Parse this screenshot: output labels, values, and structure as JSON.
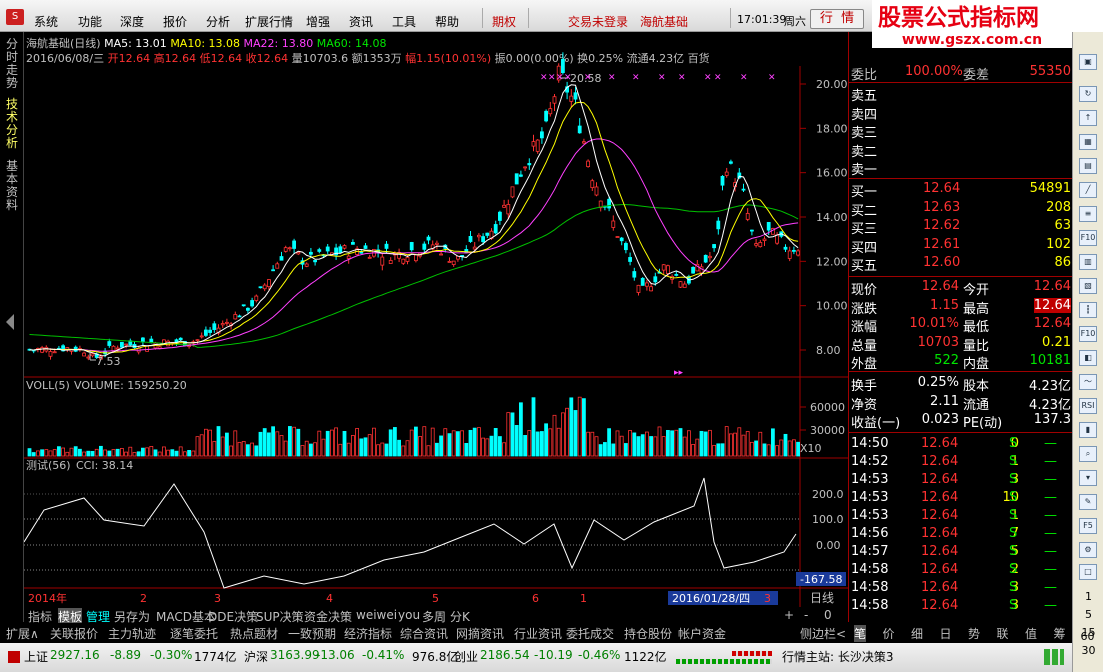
{
  "menu": {
    "items": [
      "系统",
      "功能",
      "深度",
      "报价",
      "分析",
      "扩展行情",
      "增强",
      "资讯",
      "工具",
      "帮助"
    ],
    "options_label": "期权",
    "login_status": "交易未登录",
    "stock_name": "海航基础",
    "time": "17:01:39",
    "weekday": "周六",
    "btn_quote": "行",
    "btn_info": "情",
    "watermark_title": "股票公式指标网",
    "watermark_url": "www.gszx.com.cn"
  },
  "left_tabs": [
    "分时走势",
    "技术分析",
    "基本资料"
  ],
  "chart_header": {
    "name_period": "海航基础(日线)",
    "ma5": "MA5: 13.01",
    "ma10": "MA10: 13.08",
    "ma22": "MA22: 13.80",
    "ma60": "MA60: 14.08",
    "date": "2016/06/08/三",
    "open": "开12.64",
    "high": "高12.64",
    "low": "低12.64",
    "close": "收12.64",
    "vol": "量10703.6",
    "amount": "额1353万",
    "change": "幅1.15(10.01%)",
    "amplitude": "振0.00(0.00%)",
    "turnover": "换0.25%",
    "float": "流通4.23亿",
    "sector": "百货"
  },
  "price_axis": [
    "20.00",
    "18.00",
    "16.00",
    "14.00",
    "12.00",
    "10.00",
    "8.00"
  ],
  "annotations": {
    "high": "20.58",
    "low": "7.53"
  },
  "volume_header": {
    "label": "VOLL(5)",
    "value": "VOLUME: 159250.20"
  },
  "volume_axis": [
    "60000",
    "30000",
    "X10"
  ],
  "cci_header": {
    "label": "测试(56)",
    "value": "CCI: 38.14"
  },
  "cci_axis": [
    "200.0",
    "100.0",
    "0.00",
    "-167.58"
  ],
  "x_axis": [
    "2014年",
    "2",
    "3",
    "4",
    "5",
    "6",
    "1",
    "2016/01/28/四",
    "3"
  ],
  "period_label": "日线",
  "tab_row1": [
    "指标",
    "模板",
    "管理",
    "另存为",
    "MACD基本",
    "DDE决策",
    "SUP决策",
    "资金决策",
    "weiwei",
    "you",
    "多周",
    "分K"
  ],
  "tab_row1_right": [
    "+",
    "-",
    "0"
  ],
  "tab_row2": [
    "扩展∧",
    "关联报价",
    "主力轨迹",
    "逐笔委托",
    "热点题材",
    "一致预期",
    "经济指标",
    "综合资讯",
    "网摘资讯",
    "行业资讯",
    "委托成交",
    "持仓股份",
    "帐户资金"
  ],
  "tab_row2_right": "侧边栏<",
  "side_tabs": [
    "笔",
    "价",
    "细",
    "日",
    "势",
    "联",
    "值",
    "筹"
  ],
  "order_book": {
    "weibi_label": "委比",
    "weibi": "100.00%",
    "weicha_label": "委差",
    "weicha": "55350",
    "asks": [
      {
        "label": "卖五",
        "price": "",
        "vol": ""
      },
      {
        "label": "卖四",
        "price": "",
        "vol": ""
      },
      {
        "label": "卖三",
        "price": "",
        "vol": ""
      },
      {
        "label": "卖二",
        "price": "",
        "vol": ""
      },
      {
        "label": "卖一",
        "price": "",
        "vol": ""
      }
    ],
    "bids": [
      {
        "label": "买一",
        "price": "12.64",
        "vol": "54891"
      },
      {
        "label": "买二",
        "price": "12.63",
        "vol": "208"
      },
      {
        "label": "买三",
        "price": "12.62",
        "vol": "63"
      },
      {
        "label": "买四",
        "price": "12.61",
        "vol": "102"
      },
      {
        "label": "买五",
        "price": "12.60",
        "vol": "86"
      }
    ]
  },
  "quote_stats": [
    {
      "l1": "现价",
      "v1": "12.64",
      "l2": "今开",
      "v2": "12.64"
    },
    {
      "l1": "涨跌",
      "v1": "1.15",
      "l2": "最高",
      "v2": "12.64"
    },
    {
      "l1": "涨幅",
      "v1": "10.01%",
      "l2": "最低",
      "v2": "12.64"
    },
    {
      "l1": "总量",
      "v1": "10703",
      "l2": "量比",
      "v2": "0.21"
    },
    {
      "l1": "外盘",
      "v1": "522",
      "l2": "内盘",
      "v2": "10181"
    }
  ],
  "fund_stats": [
    {
      "l1": "换手",
      "v1": "0.25%",
      "l2": "股本",
      "v2": "4.23亿"
    },
    {
      "l1": "净资",
      "v1": "2.11",
      "l2": "流通",
      "v2": "4.23亿"
    },
    {
      "l1": "收益(一)",
      "v1": "0.023",
      "l2": "PE(动)",
      "v2": "137.3"
    }
  ],
  "ticks": [
    {
      "t": "14:50",
      "p": "12.64",
      "v": "0",
      "s": "S"
    },
    {
      "t": "14:52",
      "p": "12.64",
      "v": "1",
      "s": "S"
    },
    {
      "t": "14:53",
      "p": "12.64",
      "v": "3",
      "s": "S"
    },
    {
      "t": "14:53",
      "p": "12.64",
      "v": "10",
      "s": "S"
    },
    {
      "t": "14:53",
      "p": "12.64",
      "v": "1",
      "s": "S"
    },
    {
      "t": "14:56",
      "p": "12.64",
      "v": "7",
      "s": "S"
    },
    {
      "t": "14:57",
      "p": "12.64",
      "v": "5",
      "s": "S"
    },
    {
      "t": "14:58",
      "p": "12.64",
      "v": "2",
      "s": "S"
    },
    {
      "t": "14:58",
      "p": "12.64",
      "v": "3",
      "s": "S"
    },
    {
      "t": "14:58",
      "p": "12.64",
      "v": "3",
      "s": "S"
    }
  ],
  "icon_numbers": [
    "1",
    "5",
    "15",
    "30",
    "60"
  ],
  "statusbar": {
    "sh_label": "上证",
    "sh_val": "2927.16",
    "sh_chg": "-8.89",
    "sh_pct": "-0.30%",
    "sh_amt": "1774亿",
    "sz_label": "沪深",
    "sz_val": "3163.99",
    "sz_chg": "-13.06",
    "sz_pct": "-0.41%",
    "sz_amt": "976.8亿",
    "cy_label": "创业",
    "cy_val": "2186.54",
    "cy_chg": "-10.19",
    "cy_pct": "-0.46%",
    "cy_amt": "1122亿",
    "station": "行情主站: 长沙决策3"
  },
  "colors": {
    "up": "#ff3232",
    "down": "#00ffff",
    "ma5": "#ffffff",
    "ma10": "#ffff00",
    "ma22": "#ff40ff",
    "ma60": "#00c000"
  }
}
